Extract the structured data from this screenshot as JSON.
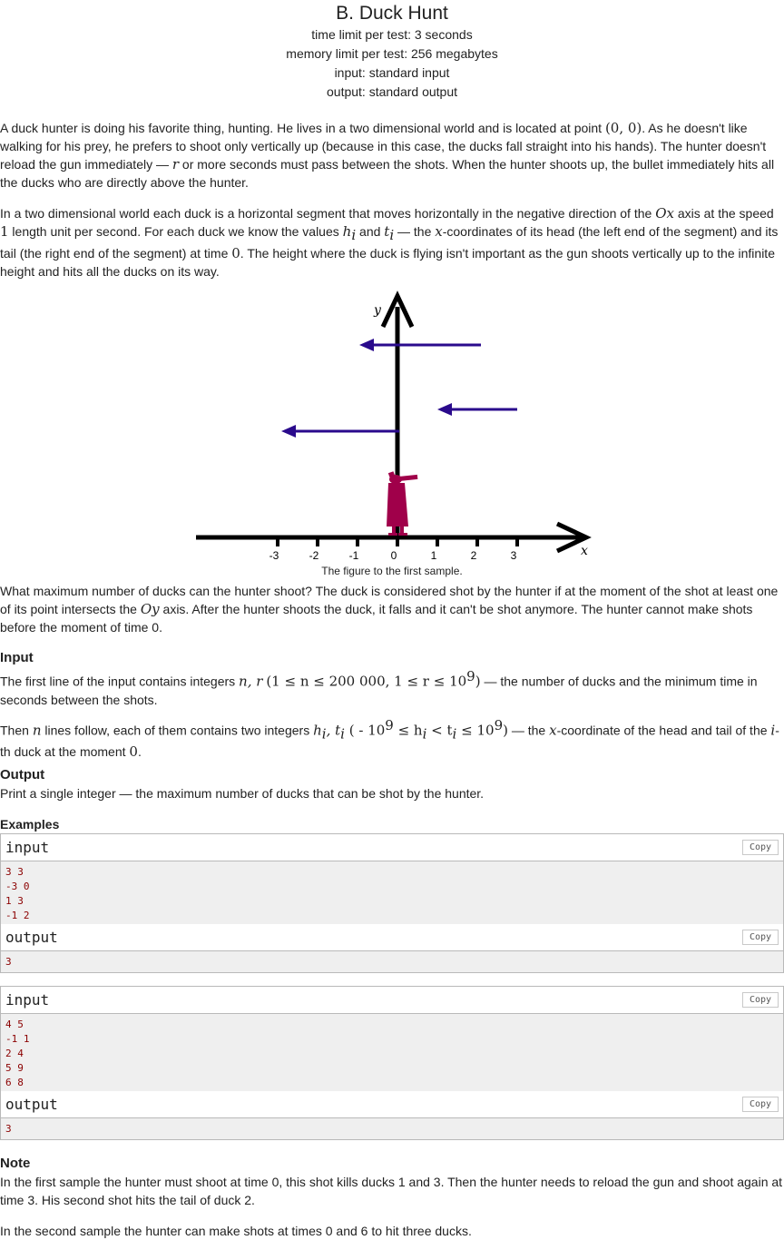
{
  "problem": {
    "title": "B. Duck Hunt",
    "time_limit": "time limit per test: 3 seconds",
    "memory_limit": "memory limit per test: 256 megabytes",
    "input_type": "input: standard input",
    "output_type": "output: standard output"
  },
  "statement": {
    "p1_a": "A duck hunter is doing his favorite thing, hunting. He lives in a two dimensional world and is located at point ",
    "p1_point": "(0, 0)",
    "p1_b": ". As he doesn't like walking for his prey, he prefers to shoot only vertically up (because in this case, the ducks fall straight into his hands). The hunter doesn't reload the gun immediately — ",
    "p1_r": "r",
    "p1_c": " or more seconds must pass between the shots. When the hunter shoots up, the bullet immediately hits all the ducks who are directly above the hunter.",
    "p2_a": "In a two dimensional world each duck is a horizontal segment that moves horizontally in the negative direction of the ",
    "p2_ox": "Ox",
    "p2_b": " axis at the speed ",
    "p2_one": "1",
    "p2_c": " length unit per second. For each duck we know the values ",
    "p2_hi": "h",
    "p2_d": " and ",
    "p2_ti": "t",
    "p2_e": " — the ",
    "p2_x": "x",
    "p2_f": "-coordinates of its head (the left end of the segment) and its tail (the right end of the segment) at time ",
    "p2_zero": "0",
    "p2_g": ". The height where the duck is flying isn't important as the gun shoots vertically up to the infinite height and hits all the ducks on its way.",
    "p3_a": "What maximum number of ducks can the hunter shoot? The duck is considered shot by the hunter if at the moment of the shot at least one of its point intersects the ",
    "p3_oy": "Oy",
    "p3_b": " axis. After the hunter shoots the duck, it falls and it can't be shot anymore. The hunter cannot make shots before the moment of time 0.",
    "sub_i": "i"
  },
  "figure": {
    "caption": "The figure to the first sample.",
    "axis_x_label": "x",
    "axis_y_label": "y",
    "ticks": [
      "-3",
      "-2",
      "-1",
      "0",
      "1",
      "2",
      "3"
    ],
    "duck_color": "#2a0a8c",
    "hunter_color": "#a0004a"
  },
  "input_section": {
    "title": "Input",
    "l1_a": "The first line of the input contains integers ",
    "l1_vars": "n, r",
    "l1_cons": "(1 ≤ n ≤ 200 000, 1 ≤ r ≤ 10",
    "l1_exp": "9",
    "l1_close": ")",
    "l1_b": " — the number of ducks and the minimum time in seconds between the shots.",
    "l2_a": "Then ",
    "l2_n": "n",
    "l2_b": " lines follow, each of them contains two integers ",
    "l2_vars": "h",
    "l2_cons_a": " ( - 10",
    "l2_cons_b": " ≤ h",
    "l2_cons_c": " < t",
    "l2_cons_d": " ≤ 10",
    "l2_c": " — the ",
    "l2_x": "x",
    "l2_d": "-coordinate of the head and tail of the ",
    "l2_i": "i",
    "l2_e": "-th duck at the moment ",
    "l2_zero": "0",
    "l2_f": "."
  },
  "output_section": {
    "title": "Output",
    "text": "Print a single integer — the maximum number of ducks that can be shot by the hunter."
  },
  "examples": {
    "title": "Examples",
    "input_label": "input",
    "output_label": "output",
    "copy_label": "Copy",
    "sample1_input": "3 3\n-3 0\n1 3\n-1 2",
    "sample1_output": "3",
    "sample2_input": "4 5\n-1 1\n2 4\n5 9\n6 8",
    "sample2_output": "3"
  },
  "note": {
    "title": "Note",
    "p1": "In the first sample the hunter must shoot at time 0, this shot kills ducks 1 and 3. Then the hunter needs to reload the gun and shoot again at time 3. His second shot hits the tail of duck 2.",
    "p2": "In the second sample the hunter can make shots at times 0 and 6 to hit three ducks."
  }
}
